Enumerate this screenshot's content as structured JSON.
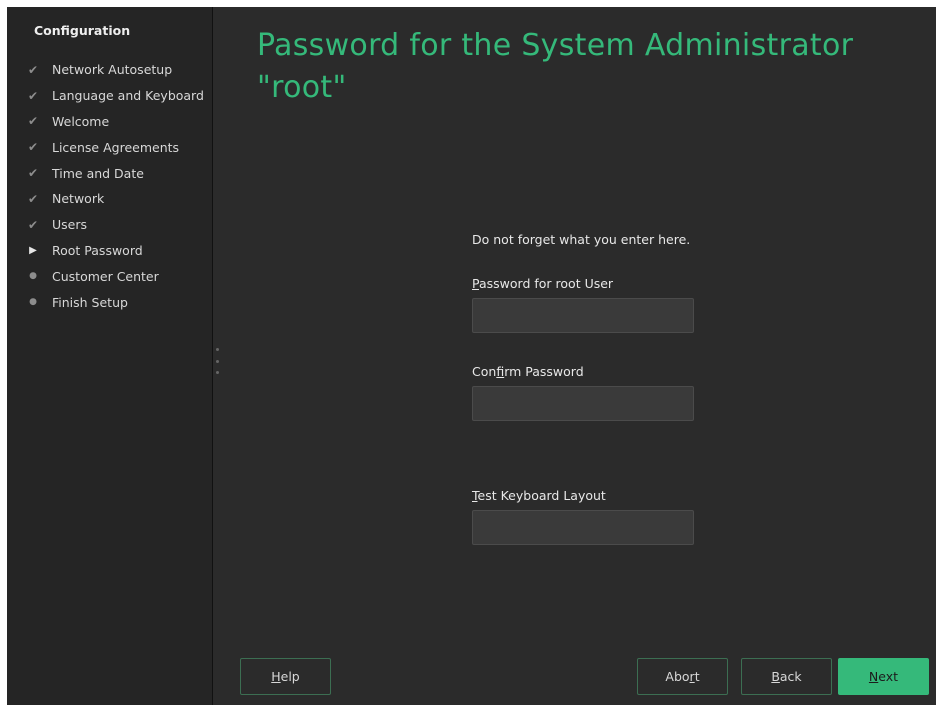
{
  "sidebar": {
    "title": "Configuration",
    "steps": [
      {
        "label": "Network Autosetup",
        "state": "done",
        "icon": "checkmark"
      },
      {
        "label": "Language and Keyboard",
        "state": "done",
        "icon": "checkmark"
      },
      {
        "label": "Welcome",
        "state": "done",
        "icon": "checkmark"
      },
      {
        "label": "License Agreements",
        "state": "done",
        "icon": "checkmark"
      },
      {
        "label": "Time and Date",
        "state": "done",
        "icon": "checkmark"
      },
      {
        "label": "Network",
        "state": "done",
        "icon": "checkmark"
      },
      {
        "label": "Users",
        "state": "done",
        "icon": "checkmark"
      },
      {
        "label": "Root Password",
        "state": "current",
        "icon": "play-arrow"
      },
      {
        "label": "Customer Center",
        "state": "pending",
        "icon": "bullet"
      },
      {
        "label": "Finish Setup",
        "state": "pending",
        "icon": "bullet"
      }
    ]
  },
  "main": {
    "title": "Password for the System Administrator \"root\"",
    "hint": "Do not forget what you enter here.",
    "password_label": {
      "mnemonic": "P",
      "rest": "assword for root User"
    },
    "confirm_label": {
      "pre": "Con",
      "mnemonic": "f",
      "rest": "irm Password"
    },
    "test_label": {
      "mnemonic": "T",
      "rest": "est Keyboard Layout"
    },
    "password_value": "",
    "confirm_value": "",
    "test_value": ""
  },
  "buttons": {
    "help": {
      "mnemonic": "H",
      "rest": "elp"
    },
    "abort": {
      "pre": "Abo",
      "mnemonic": "r",
      "rest": "t"
    },
    "back": {
      "mnemonic": "B",
      "rest": "ack"
    },
    "next": {
      "mnemonic": "N",
      "rest": "ext"
    }
  },
  "colors": {
    "accent": "#35b97a",
    "background": "#2b2b2b",
    "sidebar": "#252525",
    "field": "#3a3a3a"
  }
}
